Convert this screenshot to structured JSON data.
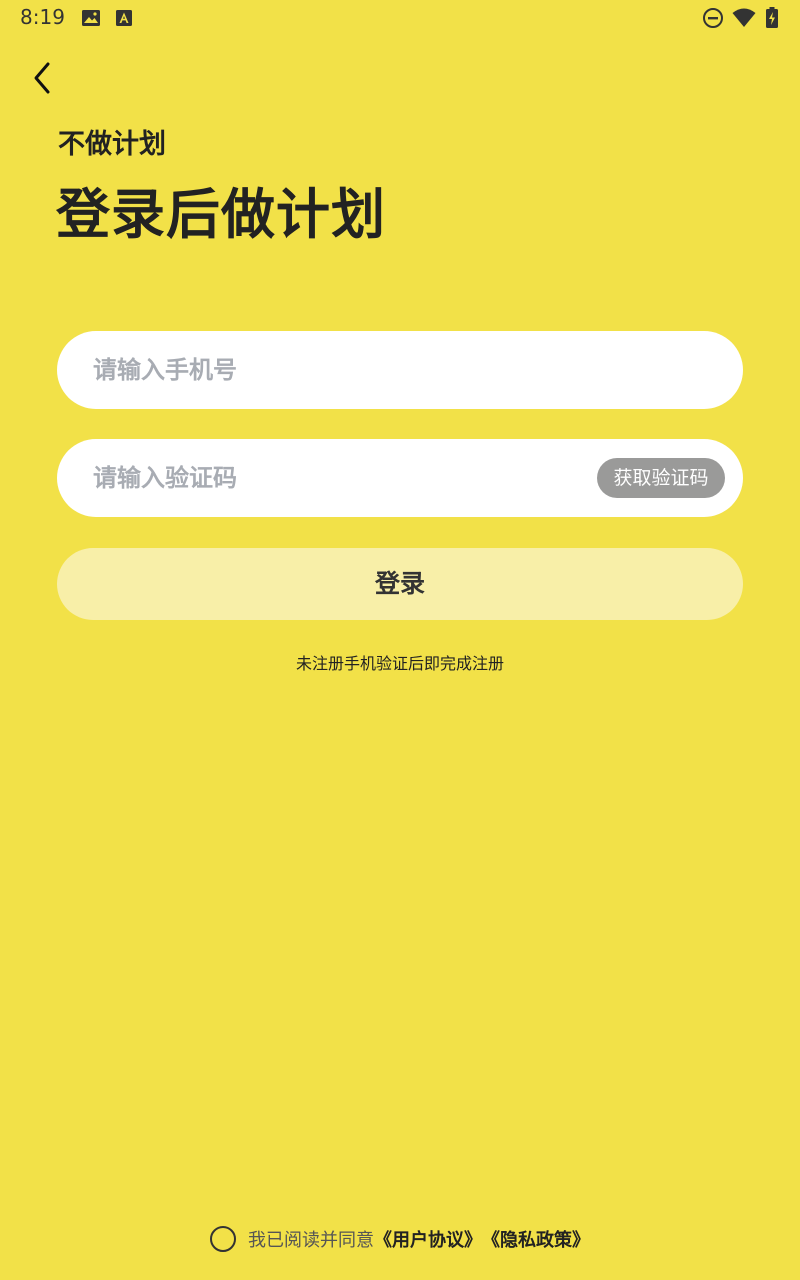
{
  "status_bar": {
    "time": "8:19",
    "left_icons": [
      "image-icon",
      "text-a-icon"
    ],
    "right_icons": [
      "do-not-disturb-icon",
      "wifi-icon",
      "battery-charging-icon"
    ]
  },
  "header": {
    "subtitle": "不做计划",
    "title": "登录后做计划"
  },
  "form": {
    "phone_placeholder": "请输入手机号",
    "phone_value": "",
    "code_placeholder": "请输入验证码",
    "code_value": "",
    "get_code_label": "获取验证码",
    "login_label": "登录",
    "register_hint": "未注册手机验证后即完成注册"
  },
  "agreement": {
    "prefix": "我已阅读并同意",
    "user_agreement": "《用户协议》",
    "privacy_policy": "《隐私政策》",
    "checked": false
  },
  "colors": {
    "background": "#F2E148",
    "login_button": "#F8EFA8",
    "code_button": "#9A9A99",
    "placeholder": "#A8ACB3"
  }
}
